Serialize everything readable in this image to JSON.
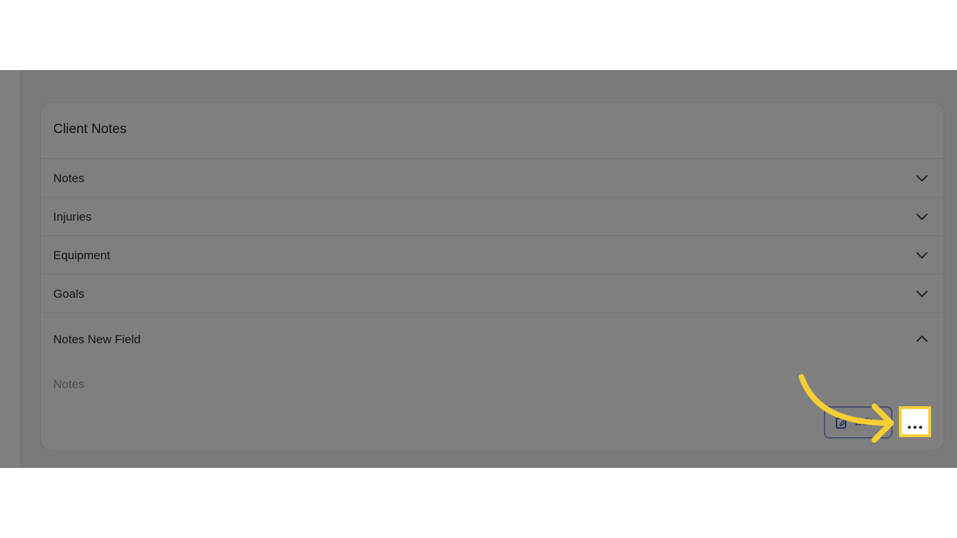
{
  "card": {
    "title": "Client Notes"
  },
  "rows": [
    {
      "label": "Notes",
      "state": "collapsed"
    },
    {
      "label": "Injuries",
      "state": "collapsed"
    },
    {
      "label": "Equipment",
      "state": "collapsed"
    },
    {
      "label": "Goals",
      "state": "collapsed"
    },
    {
      "label": "Notes New Field",
      "state": "expanded"
    }
  ],
  "expanded_section": {
    "field_label": "Notes",
    "edit_label": "Edit"
  },
  "icons": {
    "collapsed": "chevron-down-icon",
    "expanded": "chevron-up-icon",
    "edit": "edit-icon",
    "more": "more-horizontal-icon",
    "pointer": "curved-arrow-icon"
  },
  "colors": {
    "overlay": "#000000",
    "highlight": "#f7cf35",
    "edit_accent": "#4b63c9"
  }
}
